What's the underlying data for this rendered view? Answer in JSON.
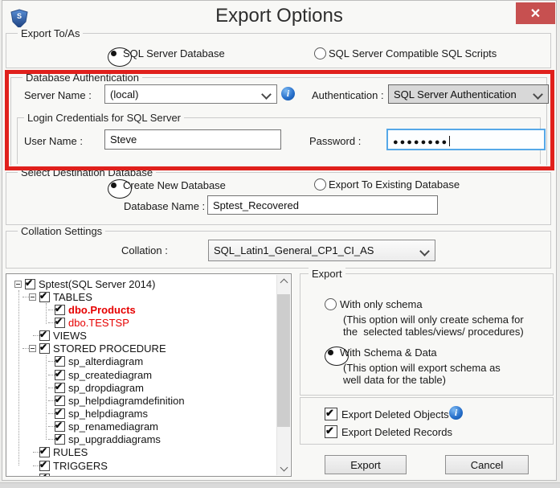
{
  "window": {
    "title": "Export Options",
    "close_glyph": "✕"
  },
  "colors": {
    "annotation_red": "#e0201c",
    "close_button_red": "#c75050",
    "highlight_item_red": "#e60000",
    "info_icon_blue": "#0c4da2",
    "focus_border_blue": "#56a8e8"
  },
  "export_to": {
    "group_label": "Export To/As",
    "options": [
      {
        "label": "SQL Server Database",
        "selected": true
      },
      {
        "label": "SQL Server Compatible SQL Scripts",
        "selected": false
      }
    ]
  },
  "database_authentication": {
    "group_label": "Database Authentication",
    "server_name_label": "Server Name :",
    "server_name_value": "(local)",
    "authentication_label": "Authentication :",
    "authentication_value": "SQL Server Authentication",
    "login_group_label": "Login Credentials for SQL Server",
    "user_name_label": "User Name :",
    "user_name_value": "Steve",
    "password_label": "Password :",
    "password_masked_value": "●●●●●●●●"
  },
  "destination": {
    "group_label": "Select Destination Database",
    "options": [
      {
        "label": "Create New Database",
        "selected": true
      },
      {
        "label": "Export To Existing Database",
        "selected": false
      }
    ],
    "database_name_label": "Database Name :",
    "database_name_value": "Sptest_Recovered"
  },
  "collation": {
    "group_label": "Collation Settings",
    "label": "Collation :",
    "value": "SQL_Latin1_General_CP1_CI_AS"
  },
  "tree": {
    "items": [
      {
        "label": "Sptest(SQL Server 2014)",
        "checked": true,
        "expanded": true
      },
      {
        "label": "TABLES",
        "checked": true,
        "expanded": true
      },
      {
        "label": "dbo.Products",
        "checked": true,
        "highlight": "red-bold"
      },
      {
        "label": "dbo.TESTSP",
        "checked": true,
        "highlight": "red"
      },
      {
        "label": "VIEWS",
        "checked": true
      },
      {
        "label": "STORED PROCEDURE",
        "checked": true,
        "expanded": true
      },
      {
        "label": "sp_alterdiagram",
        "checked": true
      },
      {
        "label": "sp_creatediagram",
        "checked": true
      },
      {
        "label": "sp_dropdiagram",
        "checked": true
      },
      {
        "label": "sp_helpdiagramdefinition",
        "checked": true
      },
      {
        "label": "sp_helpdiagrams",
        "checked": true
      },
      {
        "label": "sp_renamediagram",
        "checked": true
      },
      {
        "label": "sp_upgraddiagrams",
        "checked": true
      },
      {
        "label": "RULES",
        "checked": true
      },
      {
        "label": "TRIGGERS",
        "checked": true
      }
    ]
  },
  "export_mode": {
    "group_label": "Export",
    "options": [
      {
        "label": "With only schema",
        "selected": false,
        "desc1": "(This option will only create schema for",
        "desc2": "the  selected tables/views/ procedures)"
      },
      {
        "label": "With Schema & Data",
        "selected": true,
        "desc1": "(This option will export schema as",
        "desc2": "well data for the table)"
      }
    ]
  },
  "deleted_options": {
    "checkboxes": [
      {
        "label": "Export Deleted Objects",
        "checked": true,
        "has_info": true
      },
      {
        "label": "Export Deleted Records",
        "checked": true,
        "has_info": false
      }
    ]
  },
  "actions": {
    "export_label": "Export",
    "cancel_label": "Cancel"
  },
  "icons": {
    "info_glyph": "i"
  }
}
